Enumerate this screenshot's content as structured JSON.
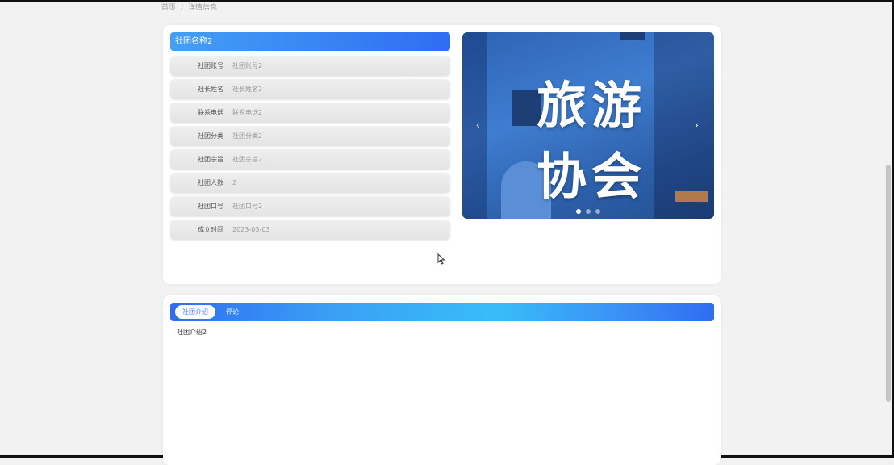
{
  "breadcrumb": {
    "home": "首页",
    "separator": "/",
    "current": "详情信息"
  },
  "club": {
    "title": "社团名称2",
    "fields": [
      {
        "label": "社团账号",
        "value": "社团账号2"
      },
      {
        "label": "社长姓名",
        "value": "社长姓名2"
      },
      {
        "label": "联系电话",
        "value": "联系电话2"
      },
      {
        "label": "社团分类",
        "value": "社团分类2"
      },
      {
        "label": "社团宗旨",
        "value": "社团宗旨2"
      },
      {
        "label": "社团人数",
        "value": "2"
      },
      {
        "label": "社团口号",
        "value": "社团口号2"
      },
      {
        "label": "成立时间",
        "value": "2023-03-03"
      }
    ]
  },
  "carousel": {
    "text_line1": "旅游",
    "text_line2": "协会",
    "prev_arrow": "‹",
    "next_arrow": "›",
    "slide_count": 3,
    "active_index": 0
  },
  "tabs": {
    "items": [
      {
        "label": "社团介绍",
        "active": true
      },
      {
        "label": "评论",
        "active": false
      }
    ]
  },
  "content": {
    "intro": "社团介绍2"
  },
  "colors": {
    "accent": "#2f6df2",
    "accent_light": "#38bdf8",
    "page_bg": "#f2f2f2"
  }
}
